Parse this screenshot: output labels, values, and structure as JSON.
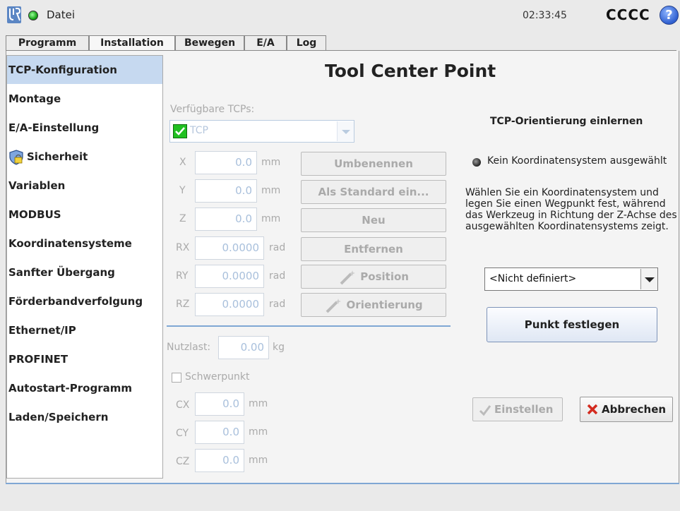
{
  "topbar": {
    "file_menu": "Datei",
    "clock": "02:33:45",
    "robot_name": "CCCC",
    "help": "?",
    "logo_icon": "ur-logo-icon",
    "status_color": "#1aa61a"
  },
  "tabs": [
    {
      "label": "Programm"
    },
    {
      "label": "Installation"
    },
    {
      "label": "Bewegen"
    },
    {
      "label": "E/A"
    },
    {
      "label": "Log"
    }
  ],
  "sidebar": {
    "items": [
      {
        "label": "TCP-Konfiguration"
      },
      {
        "label": "Montage"
      },
      {
        "label": "E/A-Einstellung"
      },
      {
        "label": "Sicherheit"
      },
      {
        "label": "Variablen"
      },
      {
        "label": "MODBUS"
      },
      {
        "label": "Koordinatensysteme"
      },
      {
        "label": "Sanfter Übergang"
      },
      {
        "label": "Förderbandverfolgung"
      },
      {
        "label": "Ethernet/IP"
      },
      {
        "label": "PROFINET"
      },
      {
        "label": "Autostart-Programm"
      },
      {
        "label": "Laden/Speichern"
      }
    ],
    "active_index": 0,
    "active_color": "#c6d9f0"
  },
  "main": {
    "title": "Tool Center Point",
    "available_label": "Verfügbare TCPs:",
    "tcp_selected": "TCP",
    "coords": [
      {
        "label": "X",
        "value": "0.0",
        "unit": "mm"
      },
      {
        "label": "Y",
        "value": "0.0",
        "unit": "mm"
      },
      {
        "label": "Z",
        "value": "0.0",
        "unit": "mm"
      },
      {
        "label": "RX",
        "value": "0.0000",
        "unit": "rad"
      },
      {
        "label": "RY",
        "value": "0.0000",
        "unit": "rad"
      },
      {
        "label": "RZ",
        "value": "0.0000",
        "unit": "rad"
      }
    ],
    "buttons": {
      "rename": "Umbenennen",
      "set_default": "Als Standard ein...",
      "new": "Neu",
      "remove": "Entfernen",
      "position": "Position",
      "orientation": "Orientierung"
    },
    "payload": {
      "label": "Nutzlast:",
      "value": "0.00",
      "unit": "kg"
    },
    "cog": {
      "label": "Schwerpunkt",
      "checked": false,
      "coords": [
        {
          "label": "CX",
          "value": "0.0",
          "unit": "mm"
        },
        {
          "label": "CY",
          "value": "0.0",
          "unit": "mm"
        },
        {
          "label": "CZ",
          "value": "0.0",
          "unit": "mm"
        }
      ]
    }
  },
  "orientation_panel": {
    "heading": "TCP-Orientierung einlernen",
    "status": "Kein Koordinatensystem ausgewählt",
    "instruction": "Wählen Sie ein Koordinatensystem und legen Sie einen Wegpunkt fest, während das Werkzeug in Richtung der Z-Achse des ausgewählten Koordinatensystems zeigt.",
    "frame_select_value": "<Nicht definiert>",
    "set_point_button": "Punkt festlegen",
    "apply_button": "Einstellen",
    "cancel_button": "Abbrechen"
  }
}
